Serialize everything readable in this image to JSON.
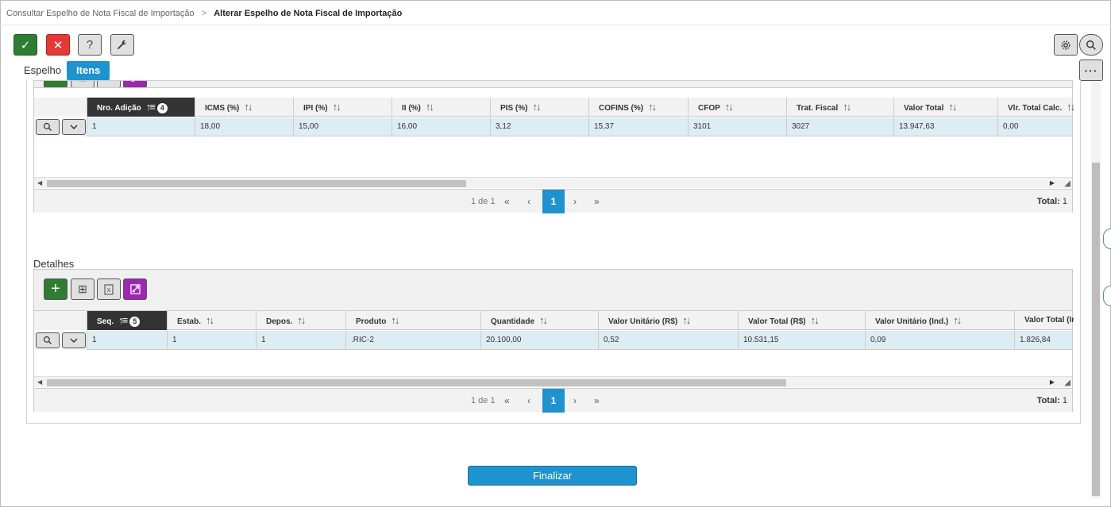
{
  "breadcrumb": {
    "parent": "Consultar Espelho de Nota Fiscal de Importação",
    "separator": ">",
    "current": "Alterar Espelho de Nota Fiscal de Importação"
  },
  "toolbar": {
    "ok_label": "✓",
    "cancel_label": "✕",
    "help_label": "?",
    "tool_label": "🔧",
    "gear_label": "⚙",
    "search_label": "🔍",
    "more_label": "···"
  },
  "tabs": [
    {
      "label": "Espelho",
      "active": false
    },
    {
      "label": "Itens",
      "active": true
    }
  ],
  "adicoes_grid": {
    "columns": [
      "Nro. Adição",
      "ICMS (%)",
      "IPI (%)",
      "II (%)",
      "PIS (%)",
      "COFINS (%)",
      "CFOP",
      "Trat. Fiscal",
      "Valor Total",
      "Vlr. Total Calc."
    ],
    "sort_badge": "4",
    "rows": [
      [
        "1",
        "18,00",
        "15,00",
        "16,00",
        "3,12",
        "15,37",
        "3101",
        "3027",
        "13.947,63",
        "0,00"
      ]
    ],
    "pager": {
      "info": "1 de 1",
      "first": "«",
      "prev": "‹",
      "current": "1",
      "next": "›",
      "last": "»",
      "total_label": "Total:",
      "total_value": "1"
    }
  },
  "detalhes": {
    "title": "Detalhes",
    "columns": [
      "Seq.",
      "Estab.",
      "Depos.",
      "Produto",
      "Quantidade",
      "Valor Unitário (R$)",
      "Valor Total (R$)",
      "Valor Unitário (Ind.)",
      "Valor Total (In"
    ],
    "sort_badge": "5",
    "rows": [
      [
        "1",
        "1",
        "1",
        ".RIC-2",
        "20.100,00",
        "0,52",
        "10.531,15",
        "0,09",
        "1.826,84"
      ]
    ],
    "pager": {
      "info": "1 de 1",
      "first": "«",
      "prev": "‹",
      "current": "1",
      "next": "›",
      "last": "»",
      "total_label": "Total:",
      "total_value": "1"
    }
  },
  "footer": {
    "finalizar_label": "Finalizar"
  },
  "colors": {
    "primary": "#1f93cd",
    "success": "#2e7d32",
    "danger": "#e53935",
    "purple": "#9c27b0",
    "row_highlight": "#dcedf3"
  }
}
